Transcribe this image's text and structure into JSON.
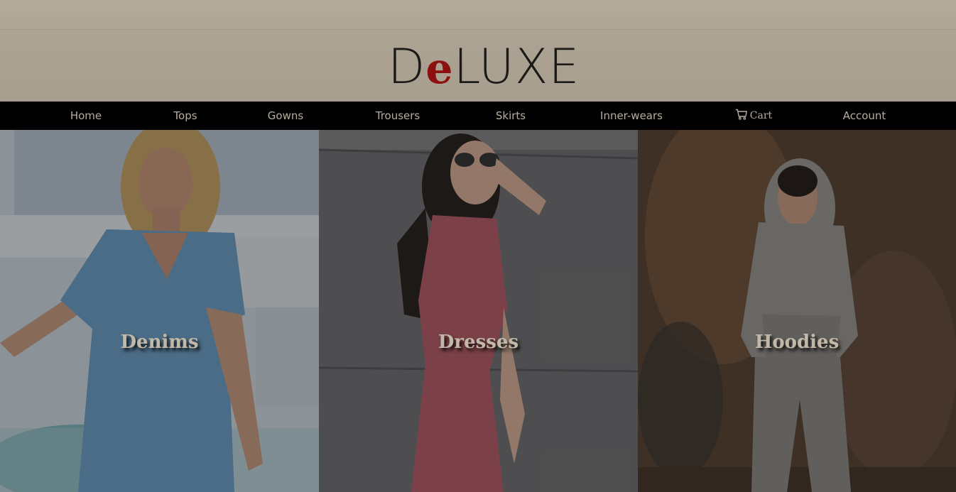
{
  "brand": {
    "logo_pre": "D",
    "logo_e": "e",
    "logo_post": "LUXE"
  },
  "nav": {
    "home": "Home",
    "tops": "Tops",
    "gowns": "Gowns",
    "trousers": "Trousers",
    "skirts": "Skirts",
    "inner_wears": "Inner-wears",
    "cart": "Cart",
    "account": "Account"
  },
  "categories": [
    {
      "label": "Denims",
      "image": "woman in light blue denim jumpsuit by a pool"
    },
    {
      "label": "Dresses",
      "image": "woman in pink ribbed dress with sunglasses"
    },
    {
      "label": "Hoodies",
      "image": "woman in grey hoodie and joggers"
    }
  ],
  "colors": {
    "header_bg": "#a8a093",
    "nav_bg": "#000000",
    "nav_text": "#b7ad9e",
    "logo_accent": "#8d1010"
  }
}
